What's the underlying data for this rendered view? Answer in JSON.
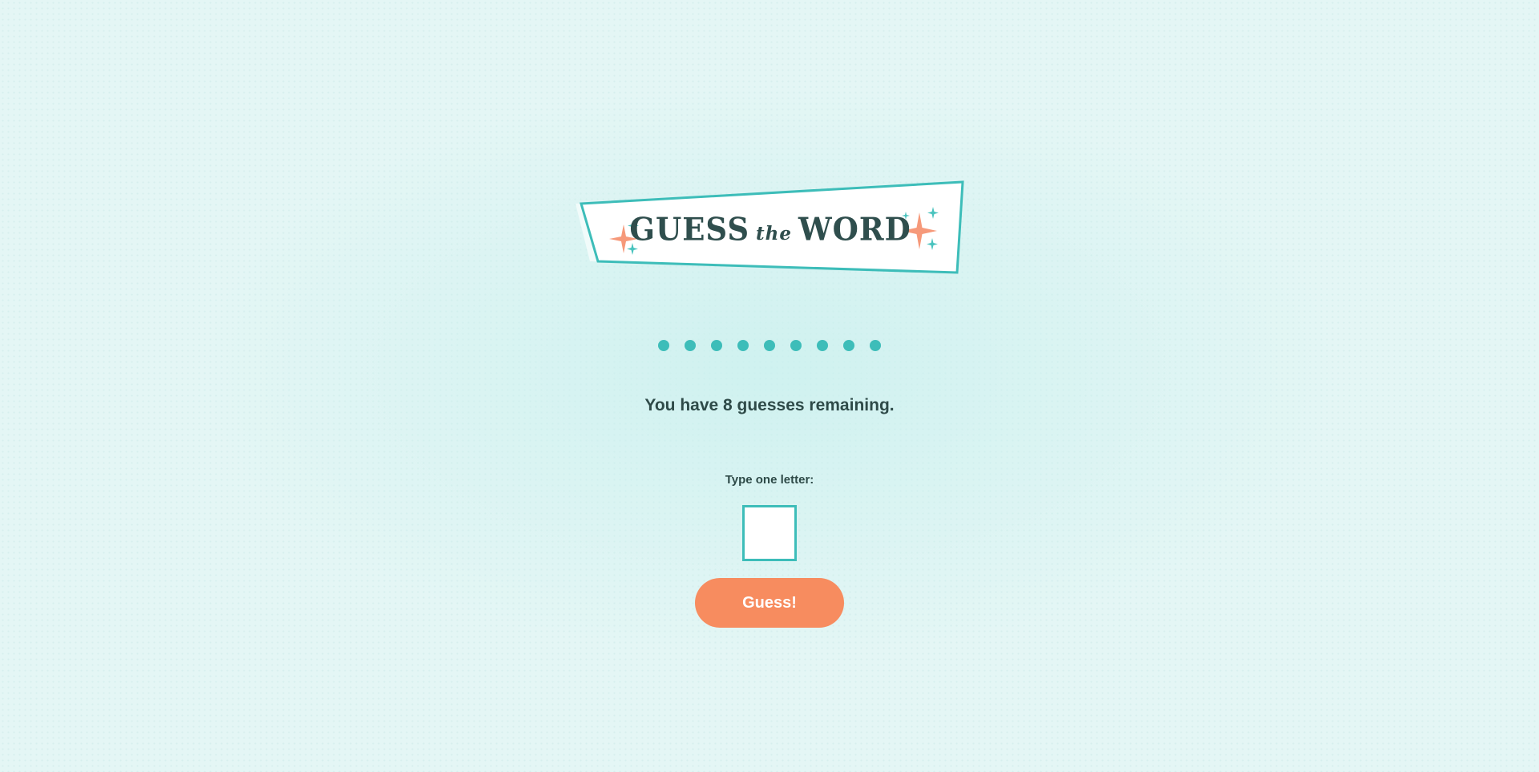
{
  "logo": {
    "word_left": "GUESS",
    "word_middle": "the",
    "word_right": "WORD"
  },
  "word_progress": {
    "placeholder_symbol": "●",
    "letter_count": 9
  },
  "status": {
    "remaining_text": "You have 8 guesses remaining."
  },
  "form": {
    "prompt_label": "Type one letter:",
    "letter_value": "",
    "guess_button_label": "Guess!"
  },
  "colors": {
    "accent_teal": "#3dbdb9",
    "button_orange": "#f78c5f",
    "text_dark": "#2e4a48",
    "sparkle_orange": "#f6997a",
    "sparkle_teal": "#49c3be"
  }
}
